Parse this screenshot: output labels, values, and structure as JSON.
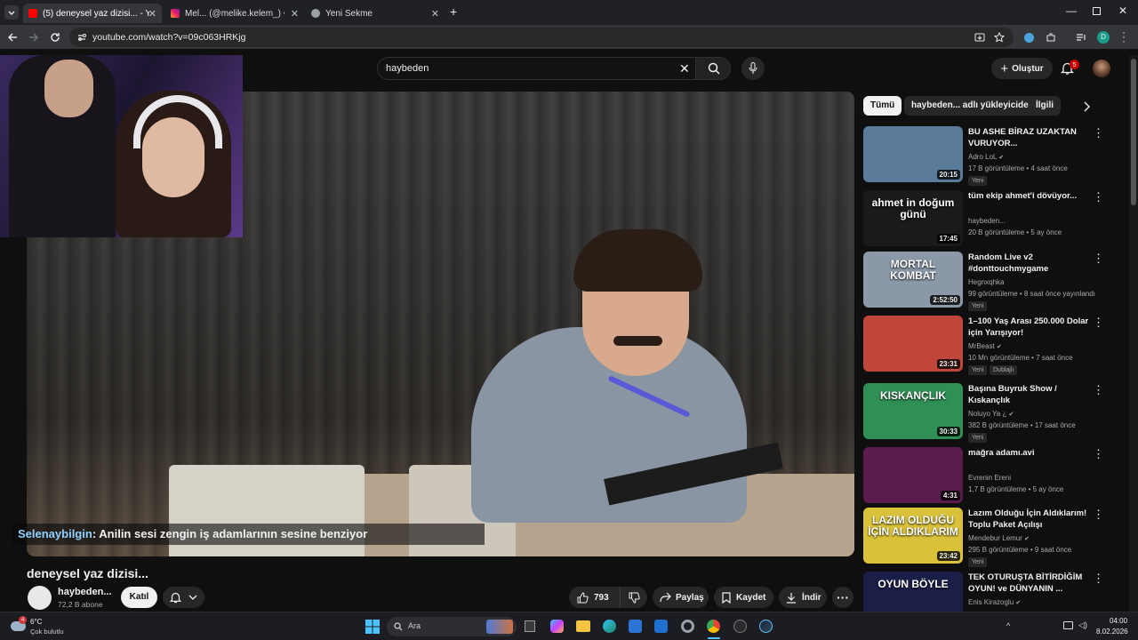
{
  "browser": {
    "tabs": [
      {
        "label": "(5) deneysel yaz dizisi... - YouTube",
        "active": true
      },
      {
        "label": "Mel... (@melike.kelem_) • Instagram",
        "active": false
      },
      {
        "label": "Yeni Sekme",
        "active": false
      }
    ],
    "url": "youtube.com/watch?v=09c063HRKjg",
    "profile_letter": "D"
  },
  "header": {
    "search_value": "haybeden",
    "create_label": "Oluştur",
    "notification_count": "5"
  },
  "player": {
    "caption_user": "Selenaybilgin",
    "caption_text": ": Anilin sesi zengin iş adamlarının sesine benziyor"
  },
  "video": {
    "title": "deneysel yaz dizisi...",
    "channel_name": "haybeden...",
    "subscribers": "72,2 B abone",
    "join_label": "Katıl",
    "like_count": "793",
    "share_label": "Paylaş",
    "save_label": "Kaydet",
    "download_label": "İndir"
  },
  "chips": [
    "Tümü",
    "haybeden... adlı yükleyiciden",
    "İlgili"
  ],
  "recommendations": [
    {
      "title": "BU ASHE BİRAZ UZAKTAN VURUYOR...",
      "channel": "Adro LoL",
      "verified": true,
      "meta": "17 B görüntüleme • 4 saat önce",
      "duration": "20:15",
      "badge": "Yeni",
      "thumb_color": "#5a7b9a"
    },
    {
      "title": "tüm ekip ahmet'i dövüyor...",
      "channel": "haybeden...",
      "verified": false,
      "meta": "20 B görüntüleme • 5 ay önce",
      "duration": "17:45",
      "badge": "",
      "thumb_text": "ahmet in doğum günü",
      "thumb_color": "#1a1a1a"
    },
    {
      "title": "Random Live v2 #donttouchmygame",
      "channel": "Hegnxqhka",
      "verified": false,
      "meta": "99 görüntüleme • 8 saat önce yayınlandı",
      "duration": "2:52:50",
      "badge": "Yeni",
      "thumb_text": "MORTAL KOMBAT",
      "thumb_color": "#8a98a8"
    },
    {
      "title": "1–100 Yaş Arası 250.000 Dolar için Yarışıyor!",
      "channel": "MrBeast",
      "verified": true,
      "meta": "10 Mn görüntüleme • 7 saat önce",
      "duration": "23:31",
      "badge": "Yeni",
      "badge2": "Dublajlı",
      "thumb_color": "#c0453a"
    },
    {
      "title": "Başına Buyruk Show / Kıskançlık",
      "channel": "Noluyo Ya ¿",
      "verified": true,
      "meta": "382 B görüntüleme • 17 saat önce",
      "duration": "30:33",
      "badge": "Yeni",
      "thumb_text": "KISKANÇLIK",
      "thumb_color": "#2f8f55"
    },
    {
      "title": "mağra adamı.avi",
      "channel": "Evrenin Ereni",
      "verified": false,
      "meta": "1,7 B görüntüleme • 5 ay önce",
      "duration": "4:31",
      "badge": "",
      "thumb_color": "#5b1c4d"
    },
    {
      "title": "Lazım Olduğu İçin Aldıklarım! Toplu Paket Açılışı",
      "channel": "Mendebur Lemur",
      "verified": true,
      "meta": "295 B görüntüleme • 9 saat önce",
      "duration": "23:42",
      "badge": "Yeni",
      "thumb_text": "LAZIM OLDUĞU İÇİN ALDIKLARIM",
      "thumb_color": "#d9c23a"
    },
    {
      "title": "TEK OTURUŞTA BİTİRDİĞİM OYUN! ve DÜNYANIN ...",
      "channel": "Enis Kirazoglu",
      "verified": true,
      "meta": "",
      "duration": "",
      "badge": "",
      "thumb_text": "OYUN BÖYLE",
      "thumb_color": "#1b1f48"
    }
  ],
  "taskbar": {
    "weather_temp": "6°C",
    "weather_desc": "Çok bulutlu",
    "weather_badge": "4",
    "search_placeholder": "Ara",
    "time": "04:00",
    "date": "8.02.2026"
  }
}
